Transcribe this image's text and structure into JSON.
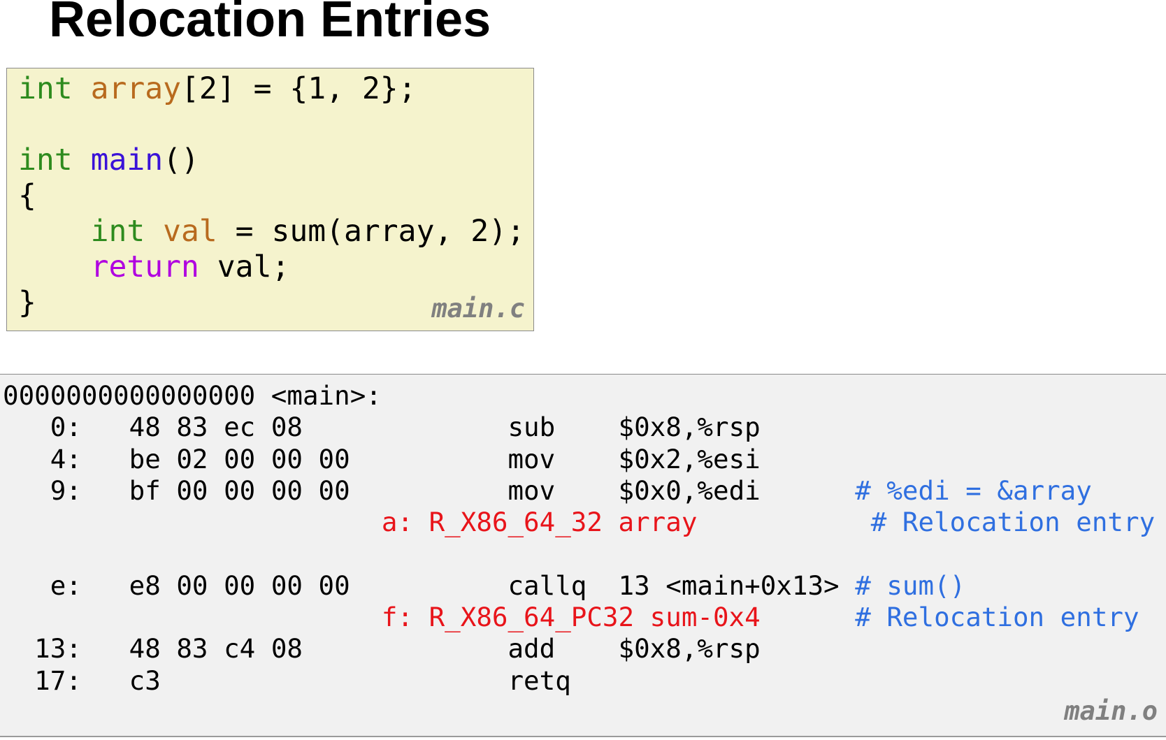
{
  "title": "Relocation Entries",
  "source": {
    "filename": "main.c",
    "l1": {
      "type": "int",
      "var": "array",
      "rest": "[2] = {1, 2};"
    },
    "l3": {
      "type": "int",
      "fn": "main",
      "rest": "()"
    },
    "l4": "{",
    "l5": {
      "indent": "    ",
      "type": "int",
      "var": "val",
      "rest": " = sum(array, 2);"
    },
    "l6": {
      "indent": "    ",
      "kw": "return",
      "rest": " val;"
    },
    "l7": "}"
  },
  "disassembly": {
    "filename": "main.o",
    "header": "0000000000000000 <main>:",
    "r0": {
      "addr": "   0:   ",
      "bytes": "48 83 ec 08             ",
      "op": "sub    ",
      "args": "$0x8,%rsp"
    },
    "r1": {
      "addr": "   4:   ",
      "bytes": "be 02 00 00 00          ",
      "op": "mov    ",
      "args": "$0x2,%esi"
    },
    "r2": {
      "addr": "   9:   ",
      "bytes": "bf 00 00 00 00          ",
      "op": "mov    ",
      "args": "$0x0,%edi      ",
      "comment": "# %edi = &array"
    },
    "reloc1": {
      "pad": "                        ",
      "text": "a: R_X86_64_32 array     ",
      "gap": "      ",
      "comment": "# Relocation entry"
    },
    "r3": {
      "addr": "   e:   ",
      "bytes": "e8 00 00 00 00          ",
      "op": "callq  ",
      "args": "13 <main+0x13> ",
      "comment": "# sum()"
    },
    "reloc2": {
      "pad": "                        ",
      "text": "f: R_X86_64_PC32 sum-0x4",
      "gap": "      ",
      "comment": "# Relocation entry"
    },
    "r4": {
      "addr": "  13:   ",
      "bytes": "48 83 c4 08             ",
      "op": "add    ",
      "args": "$0x8,%rsp"
    },
    "r5": {
      "addr": "  17:   ",
      "bytes": "c3                      ",
      "op": "retq"
    }
  },
  "colors": {
    "type_keyword": "#2e8b1e",
    "return_keyword": "#b000e0",
    "variable": "#b86a1e",
    "function": "#3a12d8",
    "relocation": "#e8141a",
    "comment": "#2f6fe0",
    "source_bg": "#f5f3cd",
    "disasm_bg": "#f1f1f1"
  }
}
